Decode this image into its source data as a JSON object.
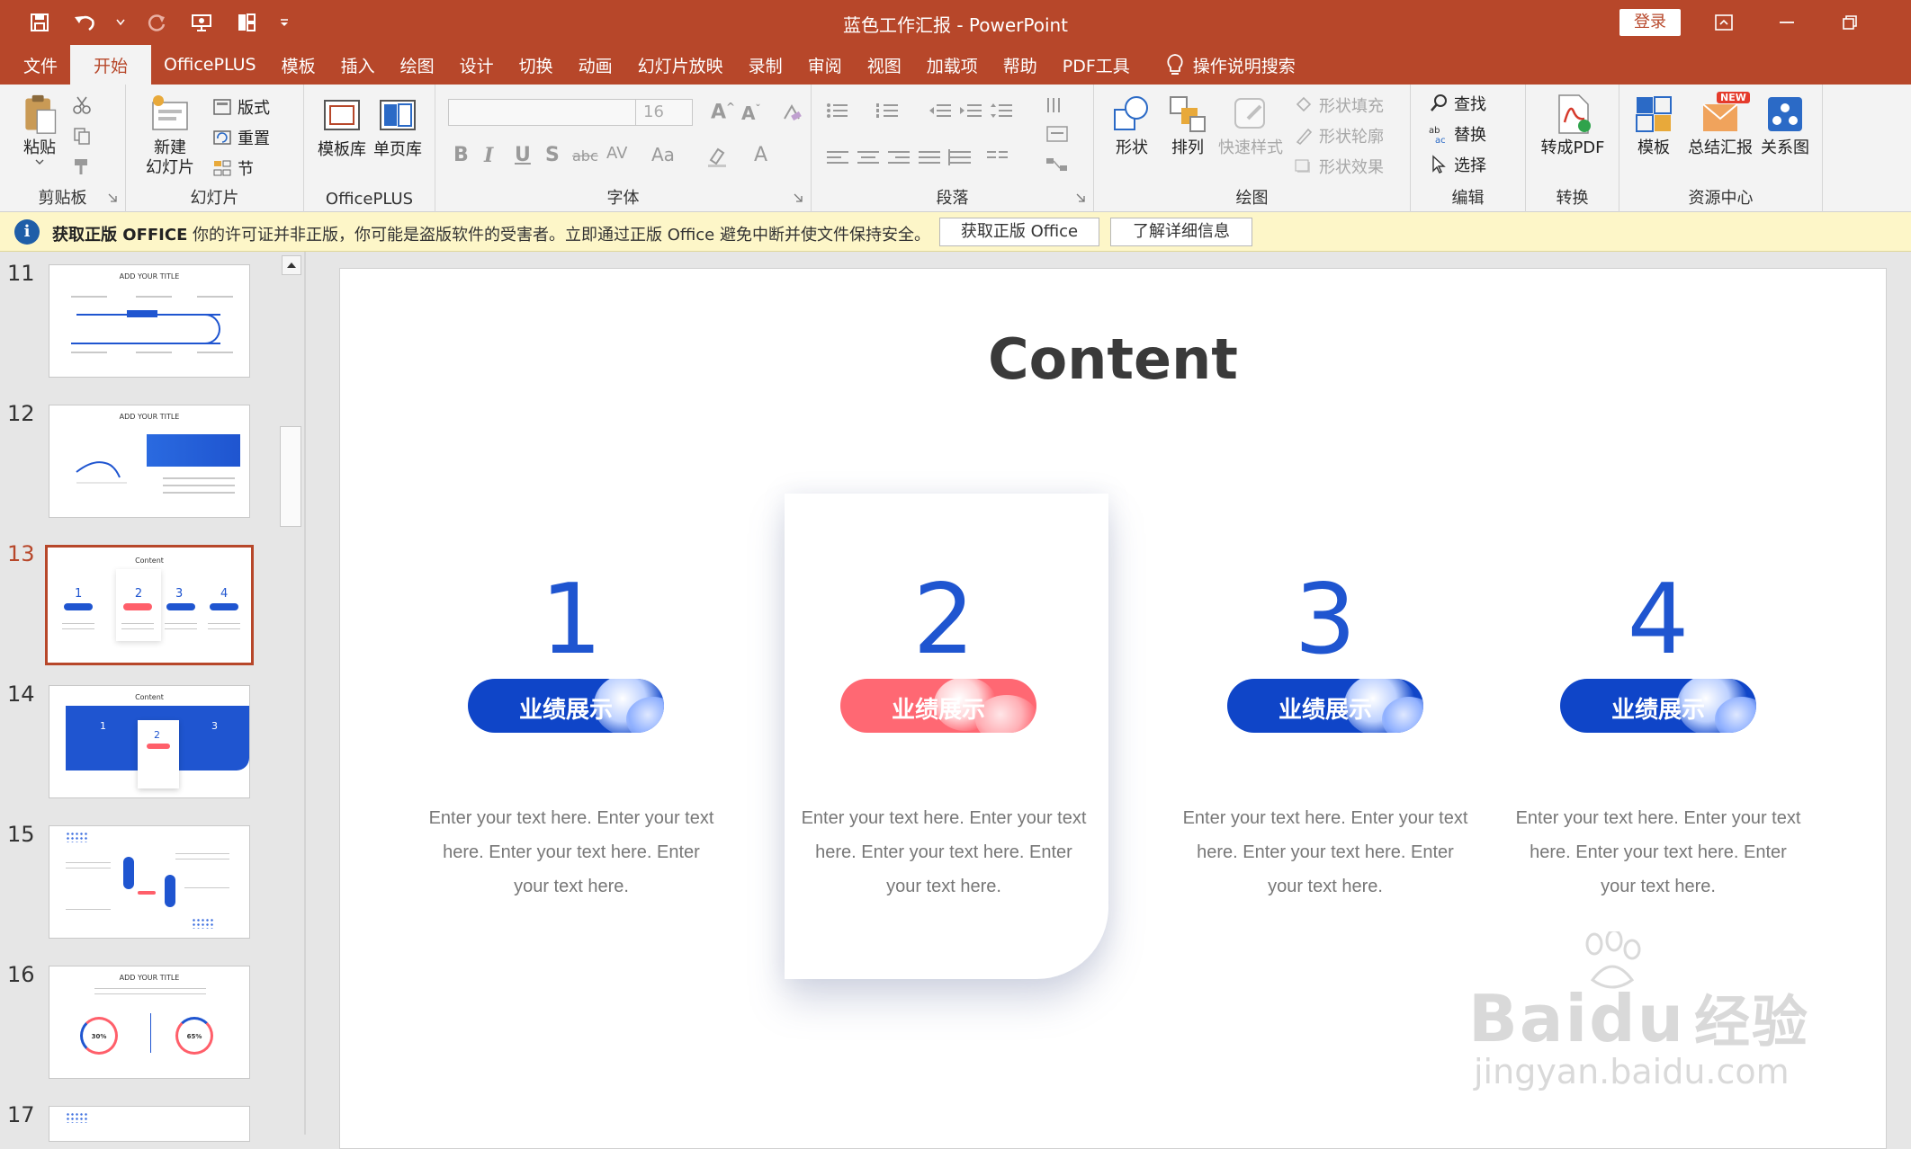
{
  "window": {
    "title": "蓝色工作汇报 - PowerPoint",
    "login_label": "登录"
  },
  "menu": {
    "tabs": [
      "文件",
      "开始",
      "OfficePLUS",
      "模板",
      "插入",
      "绘图",
      "设计",
      "切换",
      "动画",
      "幻灯片放映",
      "录制",
      "审阅",
      "视图",
      "加载项",
      "帮助",
      "PDF工具"
    ],
    "active_tab": "开始",
    "search_label": "操作说明搜索"
  },
  "ribbon": {
    "clipboard": {
      "paste": "粘贴",
      "label": "剪贴板"
    },
    "slides": {
      "new_slide_line1": "新建",
      "new_slide_line2": "幻灯片",
      "layout": "版式",
      "reset": "重置",
      "section": "节",
      "label": "幻灯片"
    },
    "officeplus": {
      "template_lib": "模板库",
      "single_page": "单页库",
      "label": "OfficePLUS"
    },
    "font": {
      "size": "16",
      "label": "字体",
      "case_label": "Aa"
    },
    "paragraph": {
      "label": "段落"
    },
    "drawing": {
      "shapes": "形状",
      "arrange": "排列",
      "quick_styles": "快速样式",
      "fill": "形状填充",
      "outline": "形状轮廓",
      "effects": "形状效果",
      "label": "绘图"
    },
    "editing": {
      "find": "查找",
      "replace": "替换",
      "select": "选择",
      "label": "编辑"
    },
    "convert": {
      "to_pdf": "转成PDF",
      "label": "转换"
    },
    "resources": {
      "template": "模板",
      "summary": "总结汇报",
      "relation": "关系图",
      "new_badge": "NEW",
      "label": "资源中心"
    }
  },
  "infobar": {
    "title": "获取正版 OFFICE",
    "message": "你的许可证并非正版，你可能是盗版软件的受害者。立即通过正版 Office 避免中断并使文件保持安全。",
    "button_get": "获取正版 Office",
    "button_learn": "了解详细信息"
  },
  "thumbnails": [
    {
      "num": "11",
      "title": "ADD YOUR TITLE"
    },
    {
      "num": "12",
      "title": "ADD YOUR TITLE"
    },
    {
      "num": "13",
      "title": "Content"
    },
    {
      "num": "14",
      "title": "Content"
    },
    {
      "num": "15",
      "title": ""
    },
    {
      "num": "16",
      "title": "ADD YOUR TITLE"
    },
    {
      "num": "17",
      "title": ""
    }
  ],
  "thumbnail_details": {
    "t13_nums": [
      "1",
      "2",
      "3",
      "4"
    ],
    "t14_nums": [
      "1",
      "2",
      "3"
    ],
    "t16_pct": [
      "30%",
      "65%"
    ]
  },
  "slide": {
    "title": "Content",
    "columns": [
      {
        "num": "1",
        "label": "业绩展示",
        "text": "Enter your text here. Enter your text here. Enter your text here. Enter your text here.",
        "color": "#0f45c8"
      },
      {
        "num": "2",
        "label": "业绩展示",
        "text": "Enter your text here. Enter your text here. Enter your text here. Enter your text here.",
        "color": "#ff6873"
      },
      {
        "num": "3",
        "label": "业绩展示",
        "text": "Enter your text here. Enter your text here. Enter your text here. Enter your text here.",
        "color": "#0f45c8"
      },
      {
        "num": "4",
        "label": "业绩展示",
        "text": "Enter your text here. Enter your text here. Enter your text here. Enter your text here.",
        "color": "#0f45c8"
      }
    ]
  },
  "watermark": {
    "brand": "Bai",
    "brand2": "du",
    "cn": "经验",
    "url": "jingyan.baidu.com"
  },
  "colors": {
    "accent": "#b7472a",
    "blue": "#1f55d0",
    "red": "#ff6873"
  }
}
